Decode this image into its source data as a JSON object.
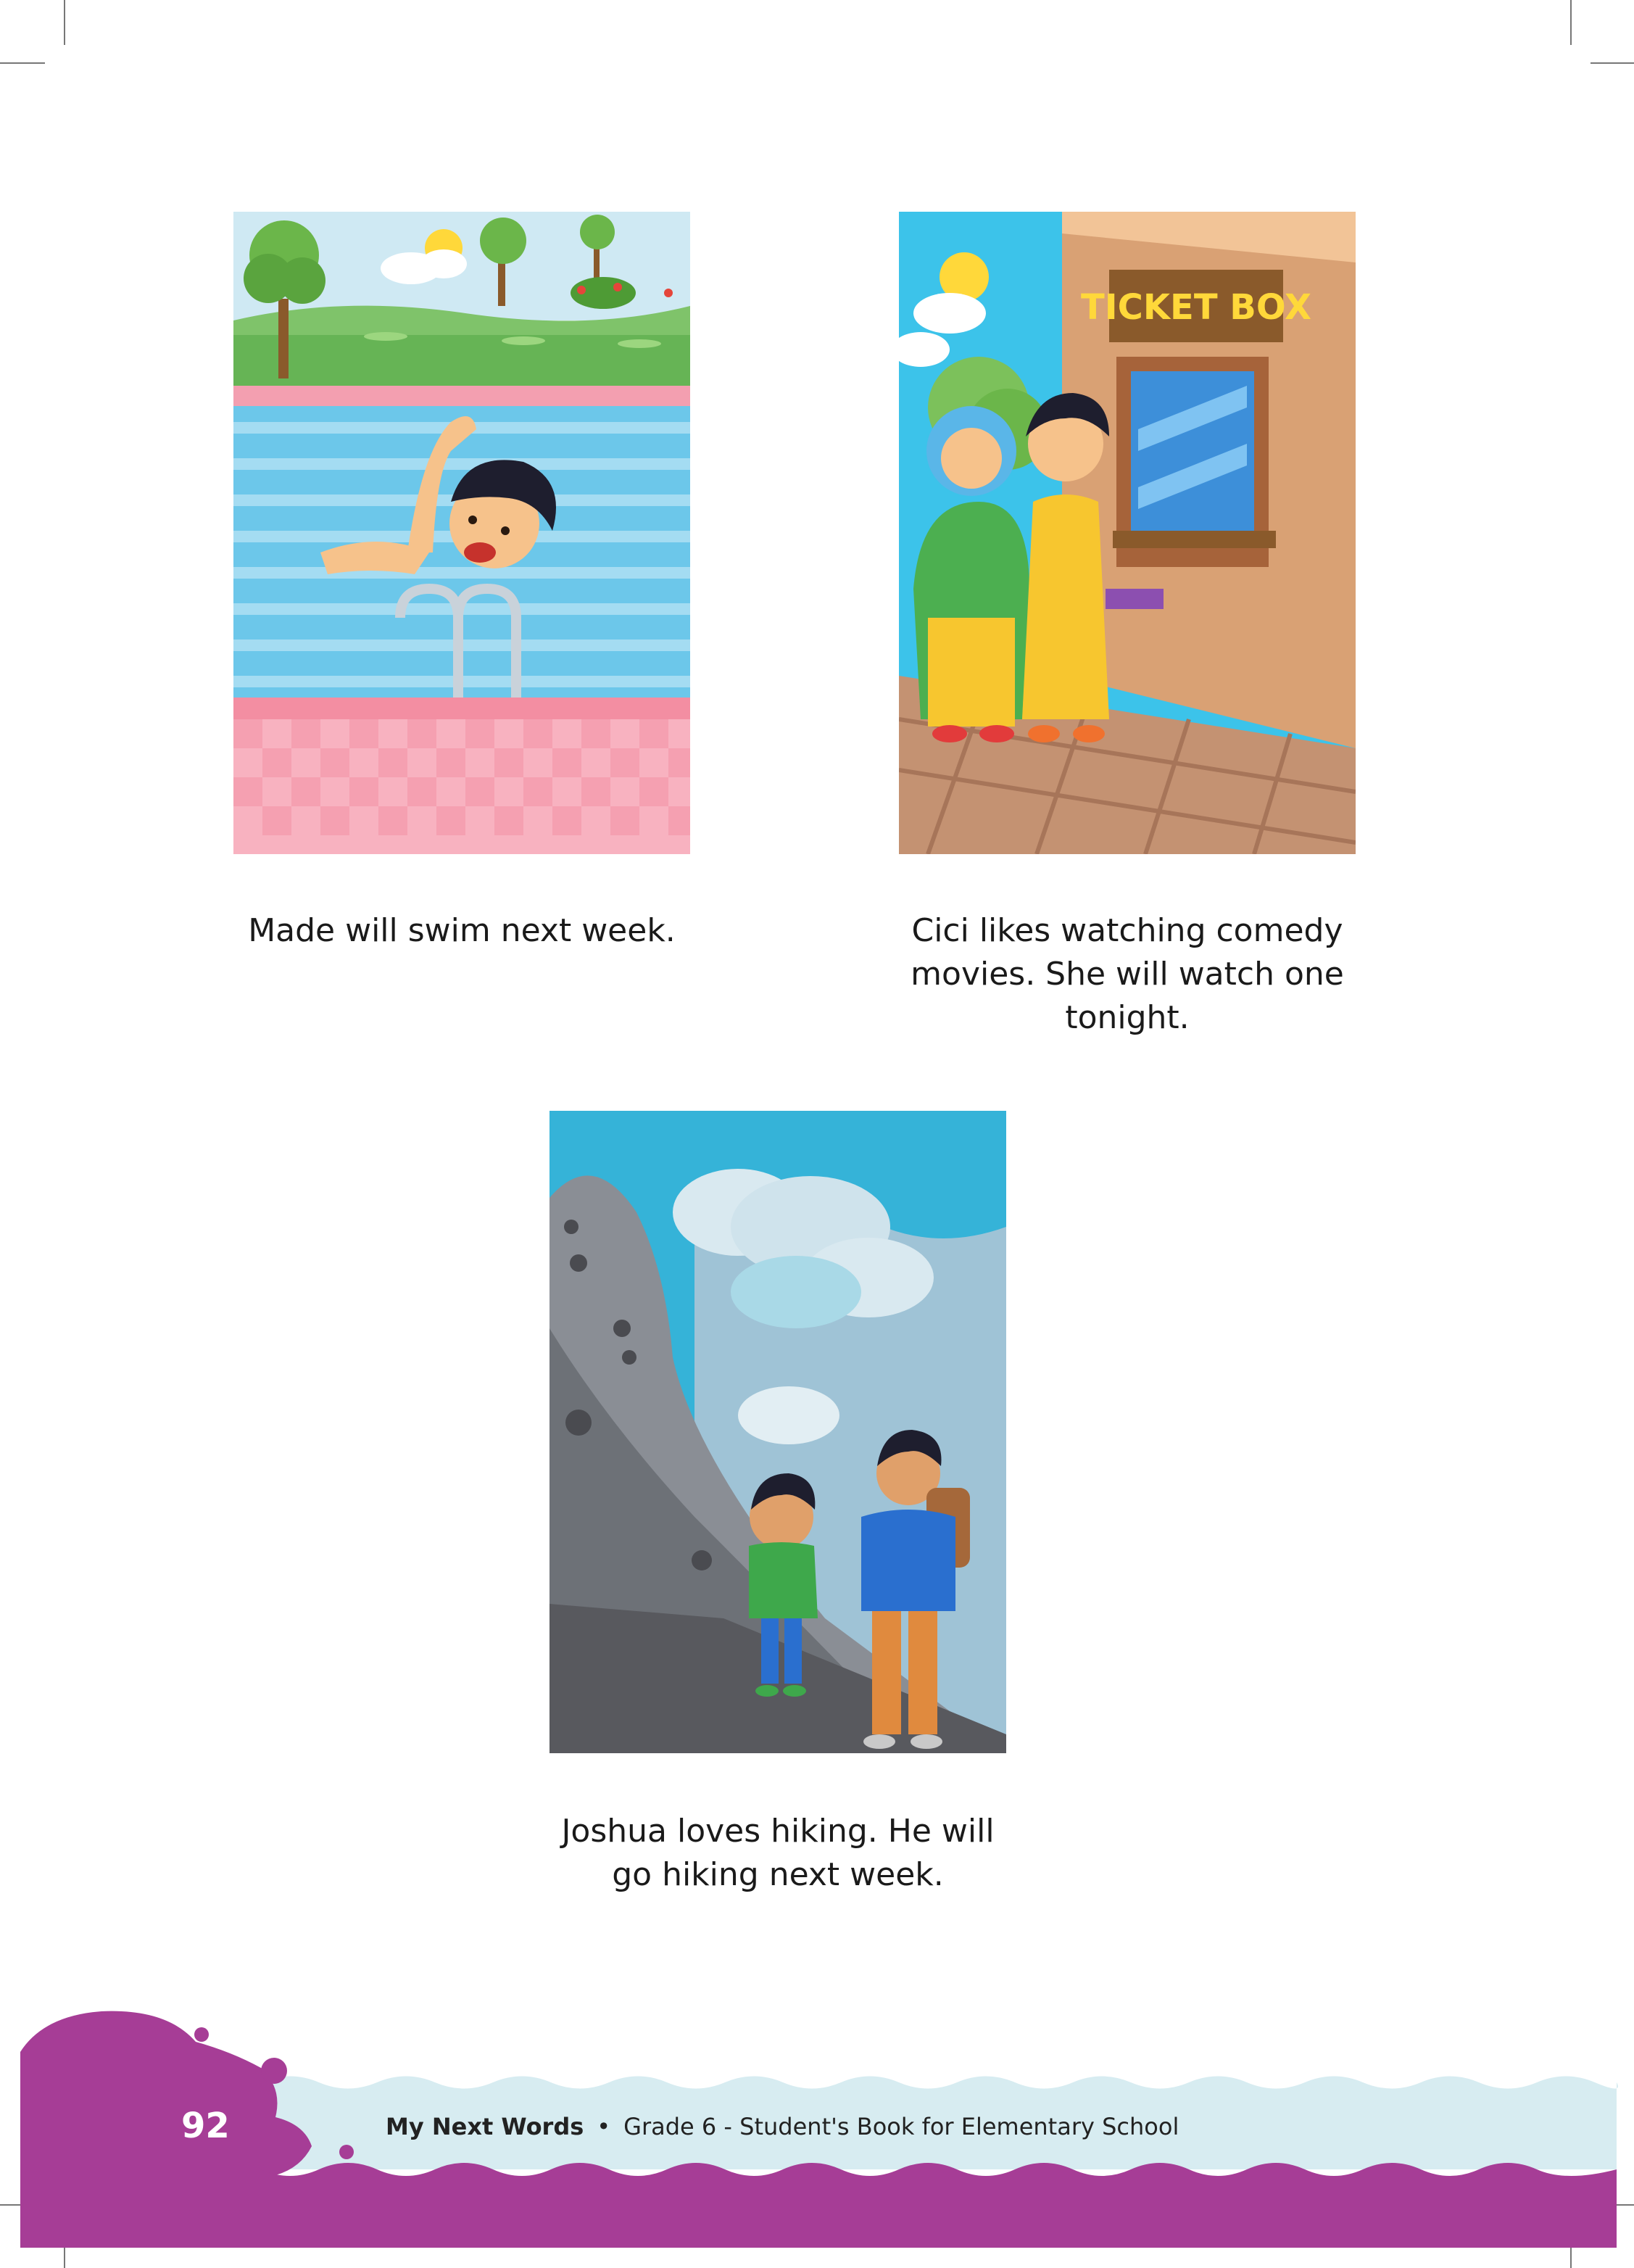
{
  "captions": {
    "swim": [
      "Made will swim next week."
    ],
    "movie": [
      "Cici likes watching comedy",
      "movies. She will watch one",
      "tonight."
    ],
    "hike": [
      "Joshua loves hiking. He will",
      "go hiking next week."
    ]
  },
  "illustrations": {
    "ticket_sign": "TICKET BOX"
  },
  "footer": {
    "page_number": "92",
    "book_title": "My Next Words",
    "separator": "•",
    "subtitle": "Grade 6 - Student's Book for Elementary School"
  },
  "colors": {
    "footer_band": "#a63d96",
    "footer_strip": "#d7ecf1",
    "pool_water": "#6cc7ea",
    "sky": "#35b3d8"
  }
}
